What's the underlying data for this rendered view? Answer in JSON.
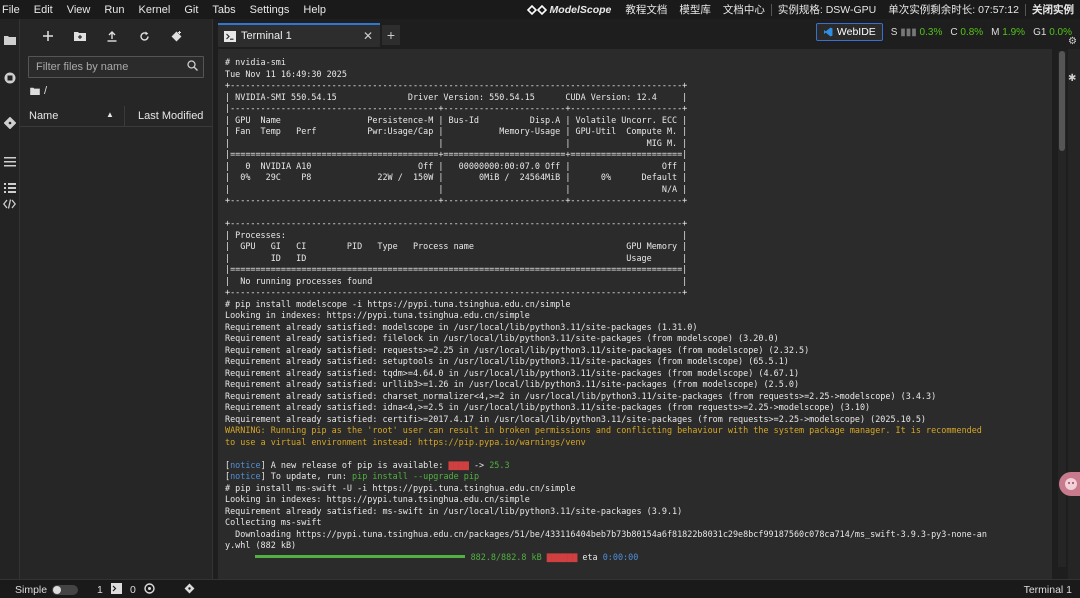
{
  "menubar": {
    "items": [
      "File",
      "Edit",
      "View",
      "Run",
      "Kernel",
      "Git",
      "Tabs",
      "Settings",
      "Help"
    ],
    "logo_text": "ModelScope",
    "links": [
      "教程文档",
      "模型库",
      "文档中心"
    ],
    "spec": "实例规格: DSW-GPU",
    "time_left": "单次实例剩余时长: 07:57:12",
    "close_instance": "关闭实例"
  },
  "filebrowser": {
    "filter_placeholder": "Filter files by name",
    "path": "/",
    "col_name": "Name",
    "col_modified": "Last Modified"
  },
  "tabs": [
    {
      "label": "Terminal 1"
    }
  ],
  "topright": {
    "webide": "WebIDE",
    "s_label": "S",
    "s_value": "0.3%",
    "c_label": "C",
    "c_value": "0.8%",
    "m_label": "M",
    "m_value": "1.9%",
    "g_label": "G1",
    "g_value": "0.0%"
  },
  "terminal": {
    "lines": [
      "# nvidia-smi",
      "Tue Nov 11 16:49:30 2025",
      "+-----------------------------------------------------------------------------------------+",
      "| NVIDIA-SMI 550.54.15              Driver Version: 550.54.15      CUDA Version: 12.4     |",
      "|-----------------------------------------+------------------------+----------------------+",
      "| GPU  Name                 Persistence-M | Bus-Id          Disp.A | Volatile Uncorr. ECC |",
      "| Fan  Temp   Perf          Pwr:Usage/Cap |           Memory-Usage | GPU-Util  Compute M. |",
      "|                                         |                        |               MIG M. |",
      "|=========================================+========================+======================|",
      "|   0  NVIDIA A10                     Off |   00000000:00:07.0 Off |                  Off |",
      "|  0%   29C    P8             22W /  150W |       0MiB /  24564MiB |      0%      Default |",
      "|                                         |                        |                  N/A |",
      "+-----------------------------------------+------------------------+----------------------+",
      "",
      "+-----------------------------------------------------------------------------------------+",
      "| Processes:                                                                              |",
      "|  GPU   GI   CI        PID   Type   Process name                              GPU Memory |",
      "|        ID   ID                                                               Usage      |",
      "|=========================================================================================|",
      "|  No running processes found                                                             |",
      "+-----------------------------------------------------------------------------------------+",
      "# pip install modelscope -i https://pypi.tuna.tsinghua.edu.cn/simple",
      "Looking in indexes: https://pypi.tuna.tsinghua.edu.cn/simple",
      "Requirement already satisfied: modelscope in /usr/local/lib/python3.11/site-packages (1.31.0)",
      "Requirement already satisfied: filelock in /usr/local/lib/python3.11/site-packages (from modelscope) (3.20.0)",
      "Requirement already satisfied: requests>=2.25 in /usr/local/lib/python3.11/site-packages (from modelscope) (2.32.5)",
      "Requirement already satisfied: setuptools in /usr/local/lib/python3.11/site-packages (from modelscope) (65.5.1)",
      "Requirement already satisfied: tqdm>=4.64.0 in /usr/local/lib/python3.11/site-packages (from modelscope) (4.67.1)",
      "Requirement already satisfied: urllib3>=1.26 in /usr/local/lib/python3.11/site-packages (from modelscope) (2.5.0)",
      "Requirement already satisfied: charset_normalizer<4,>=2 in /usr/local/lib/python3.11/site-packages (from requests>=2.25->modelscope) (3.4.3)",
      "Requirement already satisfied: idna<4,>=2.5 in /usr/local/lib/python3.11/site-packages (from requests>=2.25->modelscope) (3.10)",
      "Requirement already satisfied: certifi>=2017.4.17 in /usr/local/lib/python3.11/site-packages (from requests>=2.25->modelscope) (2025.10.5)"
    ],
    "warning_1": "WARNING: Running pip as the 'root' user can result in broken permissions and conflicting behaviour with the system package manager. It is recommended",
    "warning_2": "to use a virtual environment instead: https://pip.pypa.io/warnings/venv",
    "notice_tag": "notice",
    "notice_1": " A new release of pip is available: ",
    "notice_1_new": "25.3",
    "notice_2": " To update, run: ",
    "notice_2_cmd": "pip install --upgrade pip",
    "lines2": [
      "# pip install ms-swift -U -i https://pypi.tuna.tsinghua.edu.cn/simple",
      "Looking in indexes: https://pypi.tuna.tsinghua.edu.cn/simple",
      "Requirement already satisfied: ms-swift in /usr/local/lib/python3.11/site-packages (3.9.1)",
      "Collecting ms-swift",
      "  Downloading https://pypi.tuna.tsinghua.edu.cn/packages/51/be/433116404beb7b73b80154a6f81822b8031c29e8bcf99187560c078ca714/ms_swift-3.9.3-py3-none-an",
      "y.whl (882 kB)"
    ],
    "progress_size": "882.8/882.8 kB",
    "progress_eta_label": "eta",
    "progress_eta": "0:00:00",
    "progress_fraction": 1.0
  },
  "statusbar": {
    "mode": "Simple",
    "count_a": "1",
    "count_b": "0",
    "right": "Terminal 1"
  }
}
